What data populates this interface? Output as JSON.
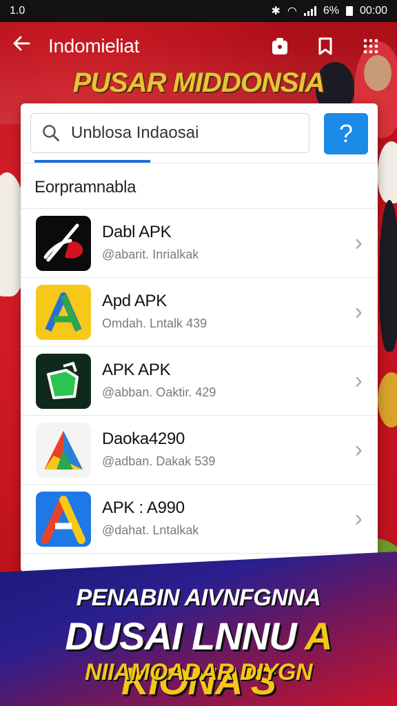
{
  "statusbar": {
    "left": "1.0",
    "battery": "6%",
    "time": "00:00"
  },
  "appbar": {
    "title": "Indomieliat"
  },
  "banner": {
    "title": "PUSAR MIDDONSIA"
  },
  "search": {
    "value": "Unblosa Indaosai",
    "help_label": "?"
  },
  "section_label": "Eorpramnabla",
  "apps": [
    {
      "name": "Dabl APK",
      "sub": "@abarit. Inrialkak",
      "icon": "dark-red-swoosh-icon"
    },
    {
      "name": "Apd APK",
      "sub": "Omdah. Lntalk 439",
      "icon": "yellow-a-icon"
    },
    {
      "name": "APK APK",
      "sub": "@abban. Oaktir. 429",
      "icon": "green-block-icon"
    },
    {
      "name": "Daoka4290",
      "sub": "@adban. Dakak 539",
      "icon": "colorful-a-icon"
    },
    {
      "name": "APK : A990",
      "sub": "@dahat. Lntalkak",
      "icon": "blue-a-icon"
    }
  ],
  "bottom_banner": {
    "line1": "PENABIN AIVNFGNNA",
    "line2_white": "DUSAI LNNU",
    "line2_yellow": "A KIONA'S",
    "line3": "NIIAMOADAR DIYGN"
  },
  "colors": {
    "accent": "#1a8be6",
    "banner_red": "#c8141f",
    "banner_gold": "#e9c23a"
  }
}
